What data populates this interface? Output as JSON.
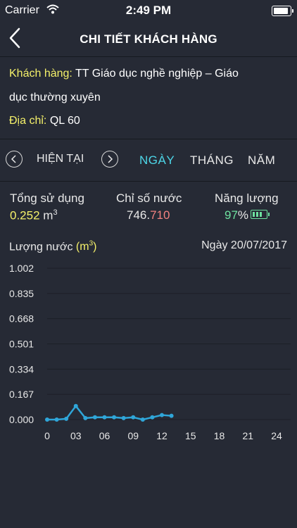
{
  "status_bar": {
    "carrier": "Carrier",
    "time": "2:49 PM"
  },
  "header": {
    "title": "CHI TIẾT KHÁCH HÀNG"
  },
  "customer": {
    "name_label": "Khách hàng:",
    "name_line1": "TT Giáo dục nghề nghiệp – Giáo",
    "name_line2": "dục thường xuyên",
    "address_label": "Địa chỉ:",
    "address_value": "QL 60"
  },
  "period": {
    "current_label": "HIỆN TẠI",
    "tabs": [
      "NGÀY",
      "THÁNG",
      "NĂM"
    ],
    "active_tab": "NGÀY"
  },
  "stats": {
    "total_label": "Tổng sử dụng",
    "total_value": "0.252",
    "total_unit": "m",
    "total_unit_exp": "3",
    "meter_label": "Chỉ số nước",
    "meter_main": "746.",
    "meter_frac": "710",
    "energy_label": "Năng lượng",
    "energy_value": "97",
    "energy_unit": "%"
  },
  "chart_header": {
    "label": "Lượng nước",
    "unit_open": "(m",
    "unit_exp": "3",
    "unit_close": ")",
    "date": "Ngày 20/07/2017"
  },
  "chart_data": {
    "type": "line",
    "ylim": [
      0,
      1.002
    ],
    "yticks": [
      "1.002",
      "0.835",
      "0.668",
      "0.501",
      "0.334",
      "0.167",
      "0.000"
    ],
    "xticks": [
      "0",
      "03",
      "06",
      "09",
      "12",
      "15",
      "18",
      "21",
      "24"
    ],
    "xlim": [
      0,
      24
    ],
    "grid": true,
    "series": [
      {
        "x": [
          0,
          1,
          2,
          3,
          4,
          5,
          6,
          7,
          8,
          9,
          10,
          11,
          12,
          13
        ],
        "values": [
          0.0,
          0.0,
          0.005,
          0.09,
          0.01,
          0.015,
          0.015,
          0.015,
          0.01,
          0.015,
          0.0,
          0.015,
          0.03,
          0.025
        ],
        "color": "#2fa6d9"
      }
    ]
  },
  "colors": {
    "accent": "#4dd6e8",
    "highlight": "#f4f06a",
    "background": "#262a35"
  }
}
